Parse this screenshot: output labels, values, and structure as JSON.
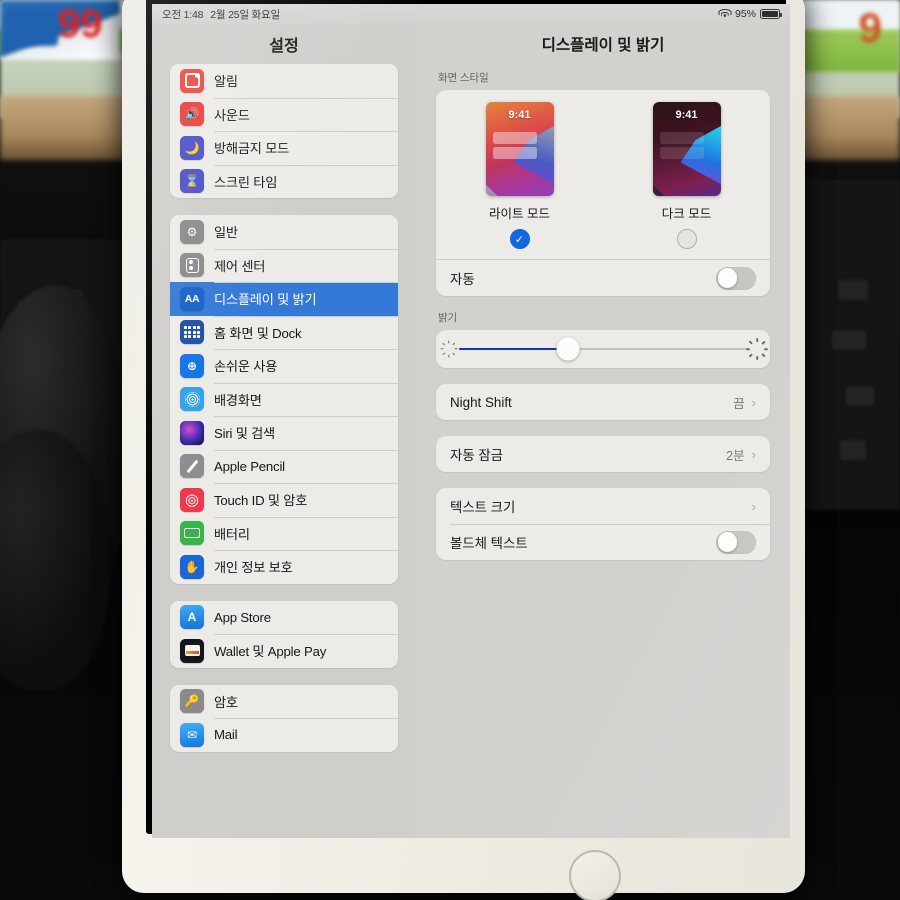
{
  "status_bar": {
    "time": "오전 1:48",
    "date": "2월 25일 화요일",
    "wifi_icon": "wifi-icon",
    "battery_percent": "95%",
    "battery_icon": "battery-full-icon"
  },
  "left_pane": {
    "title": "설정",
    "groups": [
      {
        "items": [
          {
            "label": "알림",
            "icon": "bell-icon",
            "color": "#f0463f"
          },
          {
            "label": "사운드",
            "icon": "speaker-icon",
            "color": "#ee3b3b"
          },
          {
            "label": "방해금지 모드",
            "icon": "moon-icon",
            "color": "#4a4fc8"
          },
          {
            "label": "스크린 타임",
            "icon": "hourglass-icon",
            "color": "#4a4fc8"
          }
        ]
      },
      {
        "items": [
          {
            "label": "일반",
            "icon": "gear-icon",
            "color": "#8a8a8e"
          },
          {
            "label": "제어 센터",
            "icon": "sliders-icon",
            "color": "#8a8a8e"
          },
          {
            "label": "디스플레이 및 밝기",
            "icon": "aa-icon",
            "color": "#1562c9",
            "selected": true
          },
          {
            "label": "홈 화면 및 Dock",
            "icon": "home-grid-icon",
            "color": "#1c4fa8"
          },
          {
            "label": "손쉬운 사용",
            "icon": "accessibility-icon",
            "color": "#1273e6"
          },
          {
            "label": "배경화면",
            "icon": "wallpaper-icon",
            "color": "#2fa3e8"
          },
          {
            "label": "Siri 및 검색",
            "icon": "siri-icon",
            "color": "#2b1f6e"
          },
          {
            "label": "Apple Pencil",
            "icon": "pencil-icon",
            "color": "#8d8d92"
          },
          {
            "label": "Touch ID 및 암호",
            "icon": "fingerprint-icon",
            "color": "#f0394a"
          },
          {
            "label": "배터리",
            "icon": "battery-icon",
            "color": "#38b44a"
          },
          {
            "label": "개인 정보 보호",
            "icon": "hand-icon",
            "color": "#1a65d8"
          }
        ]
      },
      {
        "items": [
          {
            "label": "App Store",
            "icon": "app-store-icon",
            "color": "#1173d8"
          },
          {
            "label": "Wallet 및 Apple Pay",
            "icon": "wallet-icon",
            "color": "#16161a"
          }
        ]
      },
      {
        "items": [
          {
            "label": "암호",
            "icon": "key-icon",
            "color": "#8a8a8e"
          },
          {
            "label": "Mail",
            "icon": "mail-icon",
            "color": "#1278de"
          }
        ]
      }
    ]
  },
  "right_pane": {
    "title": "디스플레이 및 밝기",
    "appearance": {
      "header": "화면 스타일",
      "options": [
        {
          "name": "라이트 모드",
          "preview_time": "9:41",
          "selected": true
        },
        {
          "name": "다크 모드",
          "preview_time": "9:41",
          "selected": false
        }
      ],
      "auto_label": "자동",
      "auto_enabled": false
    },
    "brightness": {
      "header": "밝기",
      "value_percent": 38,
      "low_icon": "sun-small-icon",
      "high_icon": "sun-large-icon",
      "fill_color": "#1133cc"
    },
    "cells": [
      {
        "label": "Night Shift",
        "value": "끔",
        "chevron": "›",
        "toggle": null
      },
      {
        "label": "자동 잠금",
        "value": "2분",
        "chevron": "›",
        "toggle": null
      },
      {
        "label": "텍스트 크기",
        "value": "",
        "chevron": "›",
        "toggle": null
      },
      {
        "label": "볼드체 텍스트",
        "value": "",
        "chevron": "",
        "toggle": false
      }
    ]
  },
  "device": {
    "home_button": "home-button",
    "accent_color": "#3478d8"
  }
}
